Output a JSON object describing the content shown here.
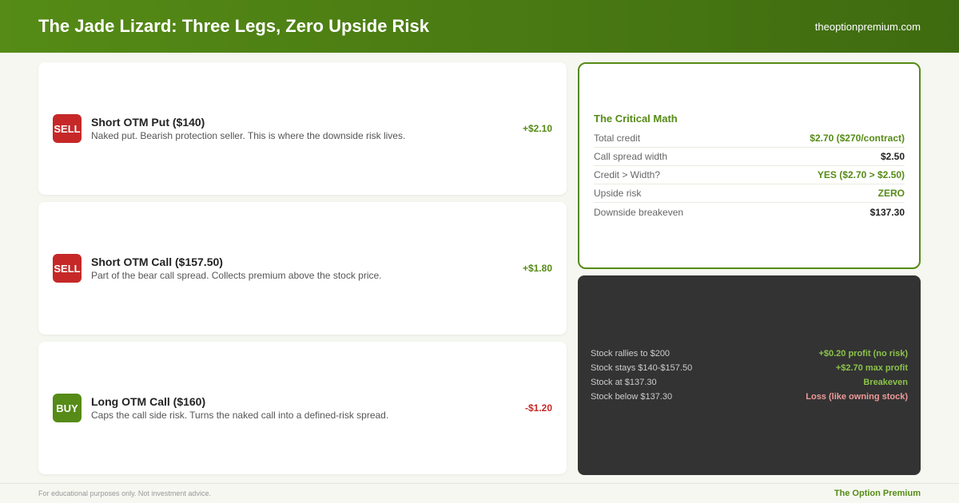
{
  "header": {
    "title": "The Jade Lizard: Three Legs, Zero Upside Risk",
    "site": "theoptionpremium.com"
  },
  "legs": [
    {
      "action": "SELL",
      "name": "Short OTM Put ($140)",
      "desc": "Naked put. Bearish protection seller. This is where the downside risk lives.",
      "amount": "+$2.10"
    },
    {
      "action": "SELL",
      "name": "Short OTM Call ($157.50)",
      "desc": "Part of the bear call spread. Collects premium above the stock price.",
      "amount": "+$1.80"
    },
    {
      "action": "BUY",
      "name": "Long OTM Call ($160)",
      "desc": "Caps the call side risk. Turns the naked call into a defined-risk spread.",
      "amount": "-$1.20"
    }
  ],
  "math": {
    "title": "The Critical Math",
    "rows": [
      {
        "label": "Total credit",
        "value": "$2.70 ($270/contract)"
      },
      {
        "label": "Call spread width",
        "value": "$2.50"
      },
      {
        "label": "Credit > Width?",
        "value": "YES ($2.70 > $2.50)"
      },
      {
        "label": "Upside risk",
        "value": "ZERO"
      },
      {
        "label": "Downside breakeven",
        "value": "$137.30"
      }
    ]
  },
  "scenarios": {
    "rows": [
      {
        "label": "Stock rallies to $200",
        "value": "+$0.20 profit (no risk)"
      },
      {
        "label": "Stock stays $140-$157.50",
        "value": "+$2.70 max profit"
      },
      {
        "label": "Stock at $137.30",
        "value": "Breakeven"
      },
      {
        "label": "Stock below $137.30",
        "value": "Loss (like owning stock)"
      }
    ]
  },
  "footer": {
    "disclaimer": "For educational purposes only. Not investment advice.",
    "brand": "The Option Premium"
  },
  "colors": {
    "brand_green": "#558b16",
    "sell_red": "#c62828",
    "dark_panel": "#333333"
  }
}
